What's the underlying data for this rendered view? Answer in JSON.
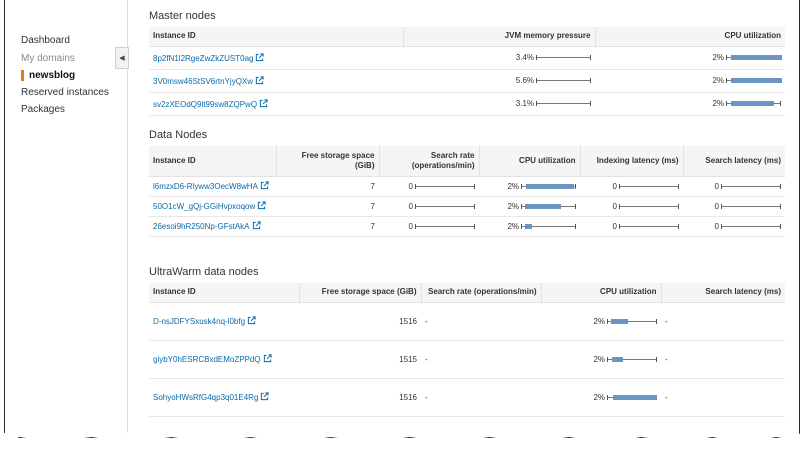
{
  "sidebar": {
    "items": [
      {
        "label": "Dashboard",
        "state": "normal"
      },
      {
        "label": "My domains",
        "state": "dim"
      },
      {
        "label": "newsblog",
        "state": "active"
      },
      {
        "label": "Reserved instances",
        "state": "normal"
      },
      {
        "label": "Packages",
        "state": "normal"
      }
    ],
    "toggle_glyph": "◀"
  },
  "master": {
    "title": "Master nodes",
    "headers": [
      "Instance ID",
      "JVM memory pressure",
      "CPU utilization"
    ],
    "rows": [
      {
        "id": "8p2fN1l2RgeZwZkZUST0ag",
        "jvm": "3.4%",
        "cpu": "2%",
        "cpu_fill": [
          0.08,
          1.0
        ]
      },
      {
        "id": "3V0msw46StSV6rtnYjyQXw",
        "jvm": "5.6%",
        "cpu": "2%",
        "cpu_fill": [
          0.08,
          1.0
        ]
      },
      {
        "id": "sv2zXEOdQ9lt99sw8ZQPwQ",
        "jvm": "3.1%",
        "cpu": "2%",
        "cpu_fill": [
          0.08,
          0.85
        ]
      }
    ]
  },
  "data_nodes": {
    "title": "Data Nodes",
    "headers": [
      "Instance ID",
      "Free storage space (GiB)",
      "Search rate (operations/min)",
      "CPU utilization",
      "Indexing latency (ms)",
      "Search latency (ms)"
    ],
    "rows": [
      {
        "id": "l6mzxD6-Rlyww3OecW8wHA",
        "storage": "7",
        "search_rate": "0",
        "cpu": "2%",
        "cpu_fill": [
          0.08,
          0.95
        ],
        "idx": "0",
        "lat": "0"
      },
      {
        "id": "50O1cW_gQj-GGiHvpxoqow",
        "storage": "7",
        "search_rate": "0",
        "cpu": "2%",
        "cpu_fill": [
          0.05,
          0.7
        ],
        "idx": "0",
        "lat": "0"
      },
      {
        "id": "26esoi9hR250Np-GFstAkA",
        "storage": "7",
        "search_rate": "0",
        "cpu": "2%",
        "cpu_fill": [
          0.05,
          0.18
        ],
        "idx": "0",
        "lat": "0"
      }
    ]
  },
  "ultrawarm": {
    "title": "UltraWarm data nodes",
    "headers": [
      "Instance ID",
      "Free storage space (GiB)",
      "Search rate (operations/min)",
      "CPU utilization",
      "Search latency (ms)"
    ],
    "rows": [
      {
        "id": "D-nsJDFYSxusk4nq-l0bfg",
        "storage": "1516",
        "search_rate": "-",
        "cpu": "2%",
        "cpu_fill": [
          0.05,
          0.4
        ],
        "lat": "-"
      },
      {
        "id": "giybY0hESRCBxdEMoZPPdQ",
        "storage": "1515",
        "search_rate": "-",
        "cpu": "2%",
        "cpu_fill": [
          0.08,
          0.3
        ],
        "lat": "-"
      },
      {
        "id": "SohyoHWsRfG4qp3q01E4Rg",
        "storage": "1516",
        "search_rate": "-",
        "cpu": "2%",
        "cpu_fill": [
          0.1,
          0.98
        ],
        "lat": "-"
      }
    ]
  },
  "icons": {
    "external_link": "external-link-icon",
    "collapse": "chevron-left-icon"
  },
  "colors": {
    "link": "#0b6aa8",
    "bar_fill": "#6a95c0",
    "active_marker": "#e47911"
  }
}
